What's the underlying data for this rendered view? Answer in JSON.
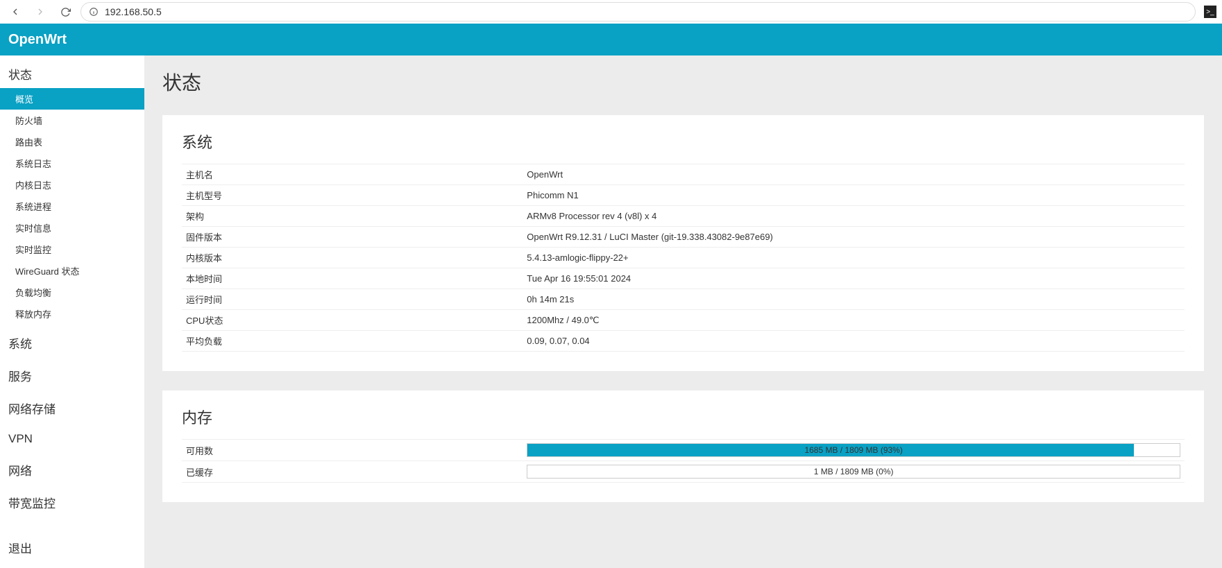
{
  "browser": {
    "url": "192.168.50.5"
  },
  "header": {
    "brand": "OpenWrt"
  },
  "sidebar": {
    "status_label": "状态",
    "items": [
      "概览",
      "防火墙",
      "路由表",
      "系统日志",
      "内核日志",
      "系统进程",
      "实时信息",
      "实时监控",
      "WireGuard 状态",
      "负载均衡",
      "释放内存"
    ],
    "categories": [
      "系统",
      "服务",
      "网络存储",
      "VPN",
      "网络",
      "带宽监控"
    ],
    "logout": "退出"
  },
  "page": {
    "title": "状态",
    "system_card": {
      "title": "系统",
      "rows": [
        {
          "k": "主机名",
          "v": "OpenWrt"
        },
        {
          "k": "主机型号",
          "v": "Phicomm N1"
        },
        {
          "k": "架构",
          "v": "ARMv8 Processor rev 4 (v8l) x 4"
        },
        {
          "k": "固件版本",
          "v": "OpenWrt R9.12.31 / LuCI Master (git-19.338.43082-9e87e69)"
        },
        {
          "k": "内核版本",
          "v": "5.4.13-amlogic-flippy-22+"
        },
        {
          "k": "本地时间",
          "v": "Tue Apr 16 19:55:01 2024"
        },
        {
          "k": "运行时间",
          "v": "0h 14m 21s"
        },
        {
          "k": "CPU状态",
          "v": "1200Mhz / 49.0℃"
        },
        {
          "k": "平均负载",
          "v": "0.09, 0.07, 0.04"
        }
      ]
    },
    "memory_card": {
      "title": "内存",
      "rows": [
        {
          "k": "可用数",
          "label": "1685 MB / 1809 MB (93%)",
          "pct": 93
        },
        {
          "k": "已缓存",
          "label": "1 MB / 1809 MB (0%)",
          "pct": 0
        }
      ]
    }
  }
}
